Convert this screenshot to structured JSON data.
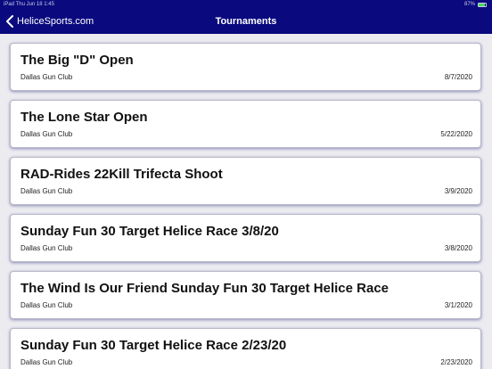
{
  "status_bar": {
    "left": "iPad  Thu Jun 18  1:45",
    "right": "87%",
    "battery_level": 0.87,
    "battery_color": "#4cd964"
  },
  "nav": {
    "back_label": "HeliceSports.com",
    "back_icon": "chevron-left-icon",
    "title": "Tournaments",
    "bar_color": "#0a0a7e"
  },
  "tournaments": [
    {
      "title": "The Big \"D\" Open",
      "club": "Dallas Gun Club",
      "date": "8/7/2020"
    },
    {
      "title": "The Lone Star Open",
      "club": "Dallas Gun Club",
      "date": "5/22/2020"
    },
    {
      "title": "RAD-Rides 22Kill Trifecta Shoot",
      "club": "Dallas Gun Club",
      "date": "3/9/2020"
    },
    {
      "title": "Sunday Fun 30 Target Helice Race 3/8/20",
      "club": "Dallas Gun Club",
      "date": "3/8/2020"
    },
    {
      "title": "The Wind Is Our Friend Sunday Fun 30 Target Helice Race",
      "club": "Dallas Gun Club",
      "date": "3/1/2020"
    },
    {
      "title": "Sunday Fun 30 Target Helice Race 2/23/20",
      "club": "Dallas Gun Club",
      "date": "2/23/2020"
    }
  ]
}
